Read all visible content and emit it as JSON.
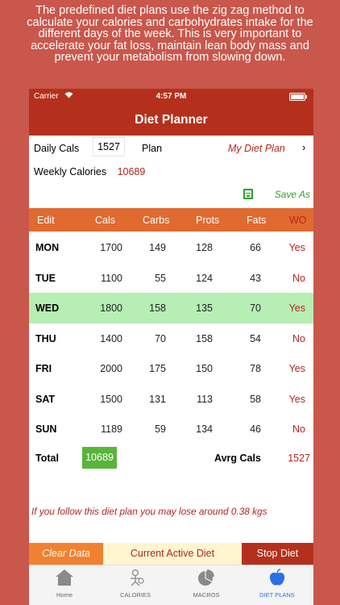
{
  "promo_text": "The predefined diet plans use the zig zag method to calculate your calories and carbohydrates intake for the different days of the week. This is very important to accelerate your fat loss, maintain lean body mass and prevent your metabolism from slowing down.",
  "status": {
    "carrier": "Carrier",
    "time": "4:57 PM"
  },
  "title": "Diet Planner",
  "daily": {
    "label": "Daily Cals",
    "value": "1527",
    "plan_label": "Plan",
    "plan_name": "My Diet Plan",
    "chevron": "›"
  },
  "weekly": {
    "label": "Weekly Calories",
    "value": "10689"
  },
  "save_as": "Save As",
  "headers": {
    "edit": "Edit",
    "cals": "Cals",
    "carbs": "Carbs",
    "prots": "Prots",
    "fats": "Fats",
    "wo": "WO"
  },
  "days": [
    {
      "day": "MON",
      "cals": "1700",
      "carbs": "149",
      "prots": "128",
      "fats": "66",
      "wo": "Yes"
    },
    {
      "day": "TUE",
      "cals": "1100",
      "carbs": "55",
      "prots": "124",
      "fats": "43",
      "wo": "No"
    },
    {
      "day": "WED",
      "cals": "1800",
      "carbs": "158",
      "prots": "135",
      "fats": "70",
      "wo": "Yes"
    },
    {
      "day": "THU",
      "cals": "1400",
      "carbs": "70",
      "prots": "158",
      "fats": "54",
      "wo": "No"
    },
    {
      "day": "FRI",
      "cals": "2000",
      "carbs": "175",
      "prots": "150",
      "fats": "78",
      "wo": "Yes"
    },
    {
      "day": "SAT",
      "cals": "1500",
      "carbs": "131",
      "prots": "113",
      "fats": "58",
      "wo": "Yes"
    },
    {
      "day": "SUN",
      "cals": "1189",
      "carbs": "59",
      "prots": "134",
      "fats": "46",
      "wo": "No"
    }
  ],
  "total": {
    "label": "Total",
    "value": "10689",
    "avg_label": "Avrg Cals",
    "avg_value": "1527"
  },
  "lose_note": "If you follow this diet plan you may lose around 0.38 kgs",
  "buttons": {
    "clear": "Clear Data",
    "current": "Current Active Diet",
    "stop": "Stop Diet"
  },
  "tabs": [
    {
      "label": "Home",
      "icon": "home-icon"
    },
    {
      "label": "CALORIES",
      "icon": "calories-icon"
    },
    {
      "label": "MACROS",
      "icon": "pie-chart-icon"
    },
    {
      "label": "DIET PLANS",
      "icon": "apple-icon"
    }
  ],
  "colors": {
    "background": "#c9574c",
    "bar": "#b5301c",
    "header": "#e06a2f",
    "active_row": "#b6eeb4",
    "accent_red": "#b3261e",
    "green": "#5ab43a",
    "active_tab": "#2a71e6"
  }
}
